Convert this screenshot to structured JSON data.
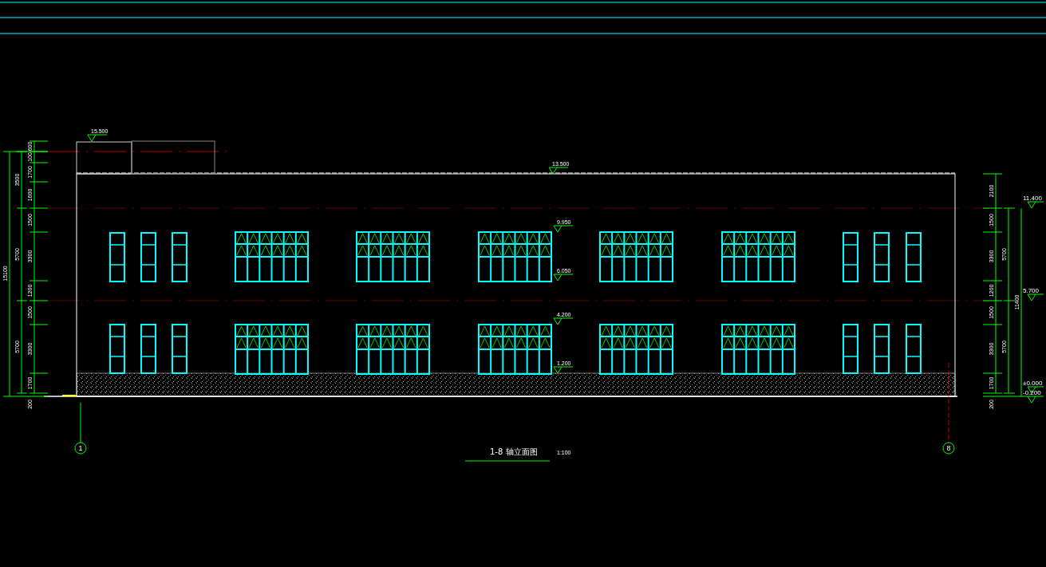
{
  "elevation_drawing": {
    "title": "1-8 轴立面图",
    "scale": "1:100",
    "level_marks": [
      "15.500",
      "13.500",
      "9.950",
      "6.050",
      "4.200",
      "1.200"
    ],
    "left_dimensions": {
      "inner": [
        "600",
        "100",
        "1700",
        "1600",
        "1500",
        "3300",
        "1200",
        "1500",
        "3300",
        "1700"
      ],
      "middle": [
        "3500",
        "5700",
        "5700"
      ],
      "overall": "15100",
      "base": "200"
    },
    "right_dimensions": {
      "inner": [
        "2100",
        "1500",
        "3300",
        "1200",
        "1500",
        "3300",
        "1700"
      ],
      "middle": [
        "5700",
        "5700"
      ],
      "overall": "11400",
      "base": "200"
    },
    "right_level_marks": [
      "11.400",
      "5.700",
      "±0.000",
      "-0.200"
    ],
    "axis_bubbles": [
      "1",
      "8"
    ]
  }
}
